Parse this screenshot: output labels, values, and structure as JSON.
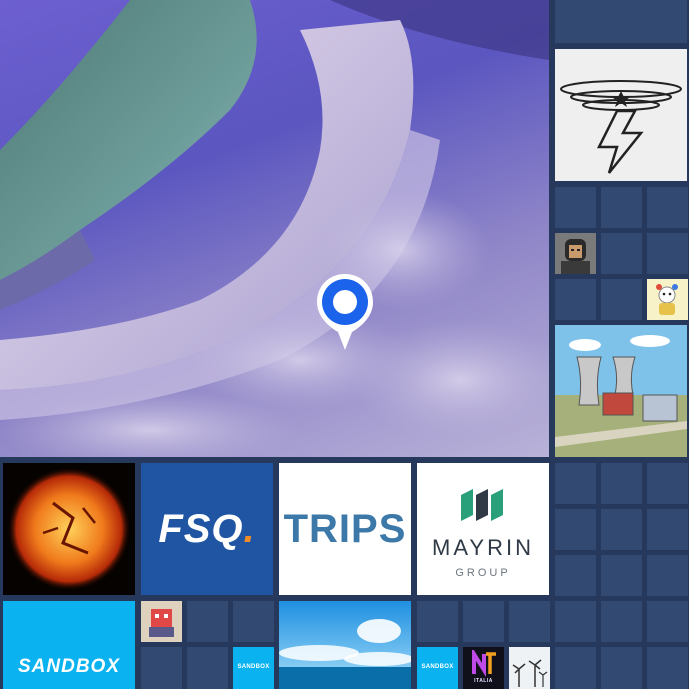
{
  "map": {
    "pin_icon": "location-pin-icon",
    "accent_color": "#1b63ea"
  },
  "tiles": {
    "fsq": {
      "label": "FSQ",
      "dot": ".",
      "bg": "#1f55a3",
      "dot_color": "#f08c28"
    },
    "trips": {
      "label": "TRIPS",
      "color": "#3c78a8"
    },
    "mayrin": {
      "name": "MAYRIN",
      "sub": "GROUP"
    },
    "sandbox_large": {
      "label": "SANDBOX",
      "bg": "#0ab3ef"
    },
    "sandbox_small_1": {
      "label": "SANDBOX"
    },
    "sandbox_small_2": {
      "label": "SANDBOX"
    },
    "nft_italia": {
      "label": "ITALIA"
    }
  },
  "colors": {
    "background": "#26395c",
    "empty_cell": "#324a72"
  }
}
